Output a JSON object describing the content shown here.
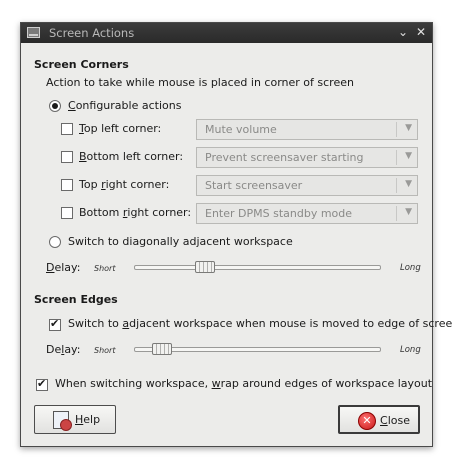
{
  "window": {
    "title": "Screen Actions"
  },
  "corners": {
    "heading": "Screen Corners",
    "description": "Action to take while mouse is placed in corner of screen",
    "configurable": {
      "label_pre": "",
      "mnemonic": "C",
      "label_post": "onfigurable actions",
      "selected": true
    },
    "rows": [
      {
        "label_pre": "",
        "mnemonic": "T",
        "label_post": "op left corner:",
        "value": "Mute volume",
        "checked": false
      },
      {
        "label_pre": "",
        "mnemonic": "B",
        "label_post": "ottom left corner:",
        "value": "Prevent screensaver starting",
        "checked": false
      },
      {
        "label_pre": "Top ",
        "mnemonic": "r",
        "label_post": "ight corner:",
        "value": "Start screensaver",
        "checked": false
      },
      {
        "label_pre": "Bottom ",
        "mnemonic": "r",
        "label_post": "ight corner:",
        "value": "Enter DPMS standby mode",
        "checked": false
      }
    ],
    "switch_diag": {
      "label": "Switch to diagonally adjacent workspace",
      "selected": false
    },
    "delay": {
      "label_pre": "",
      "mnemonic": "D",
      "label_post": "elay:",
      "short": "Short",
      "long": "Long",
      "value": 0.27
    }
  },
  "edges": {
    "heading": "Screen Edges",
    "switch_adjacent": {
      "label_pre": "Switch to ",
      "mnemonic": "a",
      "label_post": "djacent workspace when mouse is moved to edge of screen",
      "checked": true
    },
    "delay": {
      "label_pre": "De",
      "mnemonic": "l",
      "label_post": "ay:",
      "short": "Short",
      "long": "Long",
      "value": 0.08
    }
  },
  "wrap": {
    "label_pre": "When switching workspace, ",
    "mnemonic": "w",
    "label_post": "rap around edges of workspace layout",
    "checked": true
  },
  "buttons": {
    "help": {
      "mnemonic": "H",
      "label_post": "elp"
    },
    "close": {
      "mnemonic": "C",
      "label_post": "lose"
    }
  },
  "icons": {
    "close_window": "close-icon",
    "minimize": "chevron-down-icon"
  }
}
